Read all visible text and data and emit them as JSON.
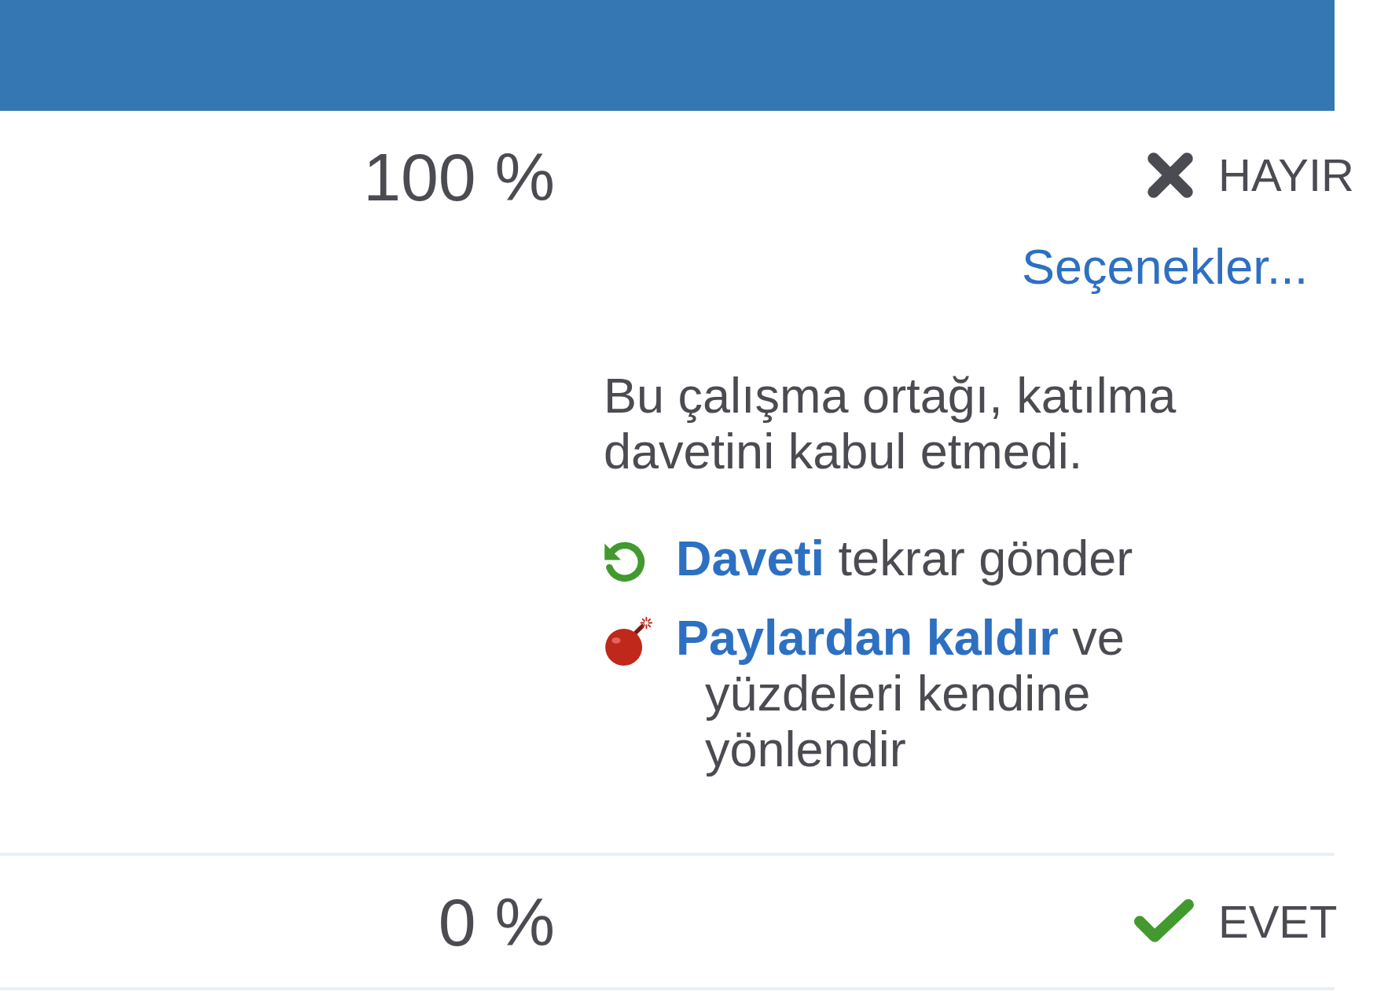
{
  "rows": [
    {
      "percentage": "100 %",
      "status": {
        "accepted": false,
        "label": "HAYIR"
      },
      "options_link": "Seçenekler...",
      "message": "Bu çalışma ortağı, katılma davetini kabul etmedi.",
      "actions": [
        {
          "kind": "resend",
          "link": "Daveti",
          "text": "tekrar gönder"
        },
        {
          "kind": "remove",
          "link": "Paylardan kaldır",
          "text": "ve yüzdeleri kendine yönlendir"
        }
      ]
    },
    {
      "percentage": "0 %",
      "status": {
        "accepted": true,
        "label": "EVET"
      }
    }
  ]
}
